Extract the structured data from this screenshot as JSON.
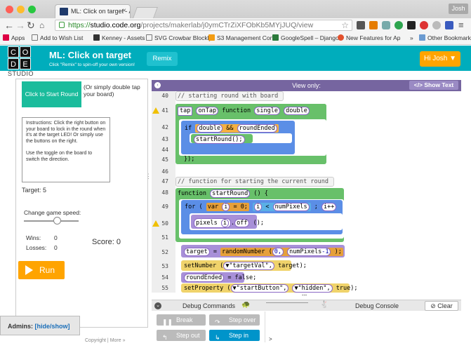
{
  "browser": {
    "tab_title": "ML: Click on target - App L",
    "profile": "Josh",
    "url_https": "https://",
    "url_host": "studio.code.org",
    "url_path": "/projects/makerlab/j0ymCTrZiXFObKb5MYjJUQ/view",
    "bookmarks": [
      "Apps",
      "Add to Wish List",
      "Kenney - Assets",
      "SVG Crowbar Blockly",
      "S3 Management Con",
      "GoogleSpell – Django",
      "New Features for Ap",
      "»",
      "Other Bookmarks"
    ]
  },
  "header": {
    "logo_letters": [
      "C",
      "O",
      "D",
      "E"
    ],
    "studio": "STUDIO",
    "title": "ML: Click on target",
    "subtitle": "Click \"Remix\" to spin-off your own version!",
    "remix": "Remix",
    "user": "Hi Josh ▼"
  },
  "app": {
    "start_button": "Click to Start Round",
    "start_hint": "(Or simply double tap your board)",
    "instructions_1": "Instructions: Click the right button on your board to lock in the round when it's at the target LED!  Or simply use the buttons on the right.",
    "instructions_2": "Use the toggle on the board to switch the direction.",
    "target": "Target: 5",
    "speed_label": "Change game speed:",
    "speed_level": 0.6,
    "wins_label": "Wins:",
    "wins": "0",
    "losses_label": "Losses:",
    "losses": "0",
    "score": "Score: 0",
    "run": "Run"
  },
  "admins": {
    "label": "Admins:",
    "link": "[hide/show]"
  },
  "footer": {
    "copyright": "Copyright",
    "sep": "|",
    "more": "More »"
  },
  "code": {
    "header_label": "View only:",
    "show_text": "</> Show Text",
    "line_numbers": [
      "40",
      "41",
      "42",
      "43",
      "44",
      "45",
      "46",
      "47",
      "48",
      "49",
      "50",
      "51",
      "52",
      "53",
      "54",
      "55"
    ],
    "comment_1": "// starting round with board",
    "comment_2": "// function for starting the current round",
    "tap": "tap",
    "onTap": "onTap",
    "function_kw": "function",
    "single": "single",
    "double": "double",
    "if_kw": "if",
    "double2": "double",
    "and_op": "&&",
    "roundEnded": "roundEnded",
    "startRound_call": "startRound();",
    "close_fn": "});",
    "startRound_def": "startRound",
    "parens": "() {",
    "for_kw": "for",
    "var_kw": "var",
    "i1": "i",
    "eq0": "= 0;",
    "i2": "i",
    "lt": "<",
    "numPixels": "numPixels",
    "semi": ";",
    "iinc": "i++",
    "pixels": "pixels",
    "i3": "i",
    "off": "off",
    "off_call": "();",
    "target_var": "target",
    "assign": "=",
    "randomNumber": "randomNumber",
    "rn_args_0": "0,",
    "rn_numPixels": "numPixels",
    "rn_minus": "-1",
    "rn_end": ");",
    "setNumber": "setNumber",
    "targetVal": "▼\"targetVal\",",
    "target_arg": "target);",
    "roundEnded2": "roundEnded",
    "assign_false": "= false;",
    "setProperty": "setProperty",
    "startButton": "▼\"startButton\",",
    "hidden": "▼\"hidden\",",
    "true_end": "true);"
  },
  "debug": {
    "commands": "Debug Commands",
    "console": "Debug Console",
    "clear": "Clear",
    "break": "Break",
    "step_over": "Step over",
    "step_out": "Step out",
    "step_in": "Step in",
    "prompt": ">"
  },
  "colors": {
    "teal": "#00adbc",
    "orange": "#ffa400",
    "purple": "#7665a0",
    "start": "#1abc9c"
  }
}
